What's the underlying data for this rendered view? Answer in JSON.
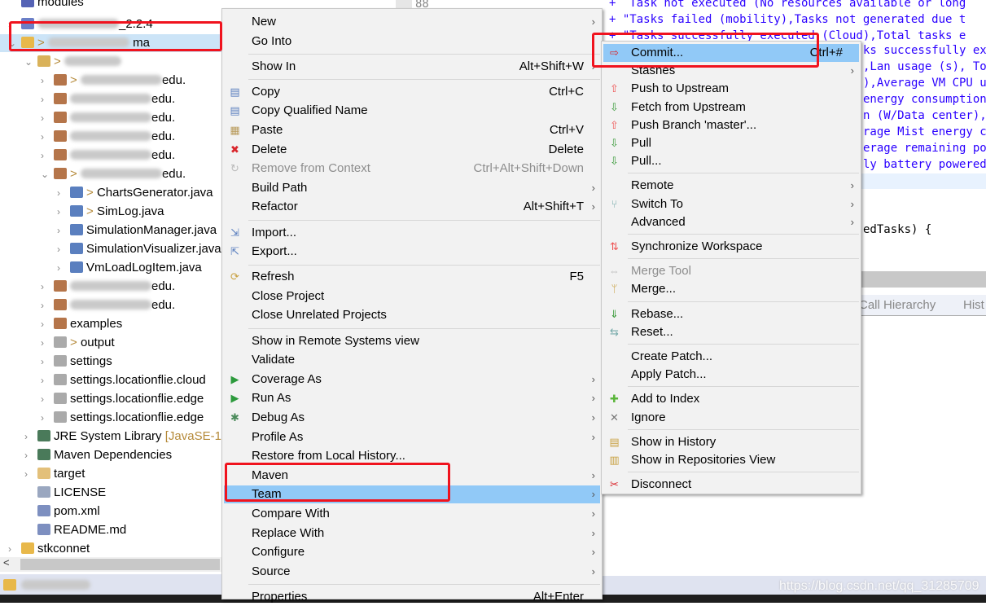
{
  "tree": {
    "rows": [
      {
        "label": "modules",
        "indent": 0,
        "icon": "module-icon",
        "twisty": ""
      },
      {
        "label": "_2.2.4",
        "indent": 0,
        "icon": "maven-project-icon",
        "twisty": ">",
        "blurred": true
      },
      {
        "label": " ma",
        "prefix": "> ",
        "indent": 0,
        "icon": "maven-project-warning-icon",
        "twisty": "v",
        "blurred": true,
        "selected": true
      },
      {
        "label": "",
        "prefix": "> ",
        "indent": 1,
        "icon": "source-folder-icon",
        "twisty": "v",
        "blurred": true
      },
      {
        "label": "edu.",
        "prefix": "> ",
        "indent": 2,
        "icon": "package-icon",
        "twisty": ">",
        "blurred": true
      },
      {
        "label": "edu.",
        "indent": 2,
        "icon": "package-icon",
        "twisty": ">",
        "blurred": true
      },
      {
        "label": "edu.",
        "indent": 2,
        "icon": "package-icon",
        "twisty": ">",
        "blurred": true
      },
      {
        "label": "edu.",
        "indent": 2,
        "icon": "package-icon",
        "twisty": ">",
        "blurred": true
      },
      {
        "label": "edu.",
        "indent": 2,
        "icon": "package-icon",
        "twisty": ">",
        "blurred": true
      },
      {
        "label": "edu.",
        "prefix": "> ",
        "indent": 2,
        "icon": "package-icon",
        "twisty": "v",
        "blurred": true
      },
      {
        "label": "ChartsGenerator.java",
        "prefix": "> ",
        "indent": 3,
        "icon": "java-file-icon",
        "twisty": ">"
      },
      {
        "label": "SimLog.java",
        "prefix": "> ",
        "indent": 3,
        "icon": "java-file-icon",
        "twisty": ">"
      },
      {
        "label": "SimulationManager.java",
        "indent": 3,
        "icon": "java-file-icon",
        "twisty": ">"
      },
      {
        "label": "SimulationVisualizer.java",
        "indent": 3,
        "icon": "java-file-icon",
        "twisty": ">"
      },
      {
        "label": "VmLoadLogItem.java",
        "indent": 3,
        "icon": "java-file-icon",
        "twisty": ">"
      },
      {
        "label": "edu.",
        "indent": 2,
        "icon": "package-icon",
        "twisty": ">",
        "blurred": true
      },
      {
        "label": "edu.",
        "indent": 2,
        "icon": "package-icon",
        "twisty": ">",
        "blurred": true
      },
      {
        "label": "examples",
        "indent": 2,
        "icon": "package-icon",
        "twisty": ">"
      },
      {
        "label": "output",
        "prefix": "> ",
        "indent": 2,
        "icon": "empty-package-icon",
        "twisty": ">"
      },
      {
        "label": "settings",
        "indent": 2,
        "icon": "empty-package-icon",
        "twisty": ">"
      },
      {
        "label": "settings.locationflie.cloud",
        "indent": 2,
        "icon": "empty-package-icon",
        "twisty": ">"
      },
      {
        "label": "settings.locationflie.edge",
        "indent": 2,
        "icon": "empty-package-icon",
        "twisty": ">"
      },
      {
        "label": "settings.locationflie.edge",
        "indent": 2,
        "icon": "empty-package-icon",
        "twisty": ">"
      },
      {
        "label": "JRE System Library",
        "suffix": " [JavaSE-1",
        "indent": 1,
        "icon": "library-icon",
        "twisty": ">"
      },
      {
        "label": "Maven Dependencies",
        "indent": 1,
        "icon": "library-icon",
        "twisty": ">"
      },
      {
        "label": "target",
        "indent": 1,
        "icon": "folder-icon",
        "twisty": ">"
      },
      {
        "label": "LICENSE",
        "indent": 1,
        "icon": "text-file-icon",
        "twisty": ""
      },
      {
        "label": "pom.xml",
        "indent": 1,
        "icon": "xml-file-icon",
        "twisty": ""
      },
      {
        "label": "README.md",
        "indent": 1,
        "icon": "markdown-file-icon",
        "twisty": ""
      },
      {
        "label": "stkconnet",
        "indent": 0,
        "icon": "project-warning-icon",
        "twisty": ">"
      }
    ]
  },
  "editor": {
    "line_number": "88",
    "lines": [
      "+  Task not executed (No resources available or long",
      "+ \"Tasks failed (mobility),Tasks not generated due t",
      "+ \"Tasks successfully executed (Cloud),Total tasks e"
    ],
    "fragments": [
      "ks successfully ex",
      ",Lan usage (s), To",
      "),Average VM CPU u",
      "energy consumption",
      "n (W/Data center),",
      "rage Mist energy c",
      "erage remaining po",
      "ly battery powered"
    ],
    "code_line": "edTasks) {",
    "tabs": [
      "Call Hierarchy",
      "Hist"
    ]
  },
  "watermark": "https://blog.csdn.net/qq_31285709",
  "context_menu": {
    "items": [
      {
        "label": "New",
        "submenu": true
      },
      {
        "label": "Go Into"
      },
      {
        "sep": true
      },
      {
        "label": "Show In",
        "shortcut": "Alt+Shift+W",
        "submenu": true
      },
      {
        "sep": true
      },
      {
        "label": "Copy",
        "shortcut": "Ctrl+C",
        "icon": "copy-icon"
      },
      {
        "label": "Copy Qualified Name",
        "icon": "copy-qualified-name-icon"
      },
      {
        "label": "Paste",
        "shortcut": "Ctrl+V",
        "icon": "paste-icon"
      },
      {
        "label": "Delete",
        "shortcut": "Delete",
        "icon": "delete-icon"
      },
      {
        "label": "Remove from Context",
        "shortcut": "Ctrl+Alt+Shift+Down",
        "icon": "remove-context-icon",
        "disabled": true
      },
      {
        "label": "Build Path",
        "submenu": true
      },
      {
        "label": "Refactor",
        "shortcut": "Alt+Shift+T",
        "submenu": true
      },
      {
        "sep": true
      },
      {
        "label": "Import...",
        "icon": "import-icon"
      },
      {
        "label": "Export...",
        "icon": "export-icon"
      },
      {
        "sep": true
      },
      {
        "label": "Refresh",
        "shortcut": "F5",
        "icon": "refresh-icon"
      },
      {
        "label": "Close Project"
      },
      {
        "label": "Close Unrelated Projects"
      },
      {
        "sep": true
      },
      {
        "label": "Show in Remote Systems view"
      },
      {
        "label": "Validate"
      },
      {
        "label": "Coverage As",
        "icon": "coverage-icon",
        "submenu": true
      },
      {
        "label": "Run As",
        "icon": "run-icon",
        "submenu": true
      },
      {
        "label": "Debug As",
        "icon": "debug-icon",
        "submenu": true
      },
      {
        "label": "Profile As",
        "submenu": true
      },
      {
        "label": "Restore from Local History..."
      },
      {
        "label": "Maven",
        "submenu": true
      },
      {
        "label": "Team",
        "submenu": true,
        "highlighted": true
      },
      {
        "label": "Compare With",
        "submenu": true
      },
      {
        "label": "Replace With",
        "submenu": true
      },
      {
        "label": "Configure",
        "submenu": true
      },
      {
        "label": "Source",
        "submenu": true
      },
      {
        "sep": true
      },
      {
        "label": "Properties",
        "shortcut": "Alt+Enter"
      }
    ]
  },
  "team_menu": {
    "items": [
      {
        "label": "Commit...",
        "shortcut": "Ctrl+#",
        "icon": "commit-icon",
        "highlighted": true
      },
      {
        "label": "Stashes",
        "submenu": true
      },
      {
        "label": "Push to Upstream",
        "icon": "push-icon"
      },
      {
        "label": "Fetch from Upstream",
        "icon": "fetch-icon"
      },
      {
        "label": "Push Branch 'master'...",
        "icon": "push-branch-icon"
      },
      {
        "label": "Pull",
        "icon": "pull-icon"
      },
      {
        "label": "Pull...",
        "icon": "pull-dialog-icon"
      },
      {
        "sep": true
      },
      {
        "label": "Remote",
        "submenu": true
      },
      {
        "label": "Switch To",
        "icon": "switch-branch-icon",
        "submenu": true
      },
      {
        "label": "Advanced",
        "submenu": true
      },
      {
        "sep": true
      },
      {
        "label": "Synchronize Workspace",
        "icon": "synchronize-icon"
      },
      {
        "sep": true
      },
      {
        "label": "Merge Tool",
        "icon": "merge-tool-icon",
        "disabled": true
      },
      {
        "label": "Merge...",
        "icon": "merge-icon"
      },
      {
        "sep": true
      },
      {
        "label": "Rebase...",
        "icon": "rebase-icon"
      },
      {
        "label": "Reset...",
        "icon": "reset-icon"
      },
      {
        "sep": true
      },
      {
        "label": "Create Patch..."
      },
      {
        "label": "Apply Patch..."
      },
      {
        "sep": true
      },
      {
        "label": "Add to Index",
        "icon": "add-to-index-icon"
      },
      {
        "label": "Ignore",
        "icon": "ignore-icon"
      },
      {
        "sep": true
      },
      {
        "label": "Show in History",
        "icon": "history-icon"
      },
      {
        "label": "Show in Repositories View",
        "icon": "git-repositories-icon"
      },
      {
        "sep": true
      },
      {
        "label": "Disconnect",
        "icon": "disconnect-icon"
      }
    ]
  },
  "colors": {
    "highlight": "#91c9f7",
    "annotation": "#f0131e",
    "code": "#2a00ff",
    "selection": "#cce4f7"
  }
}
